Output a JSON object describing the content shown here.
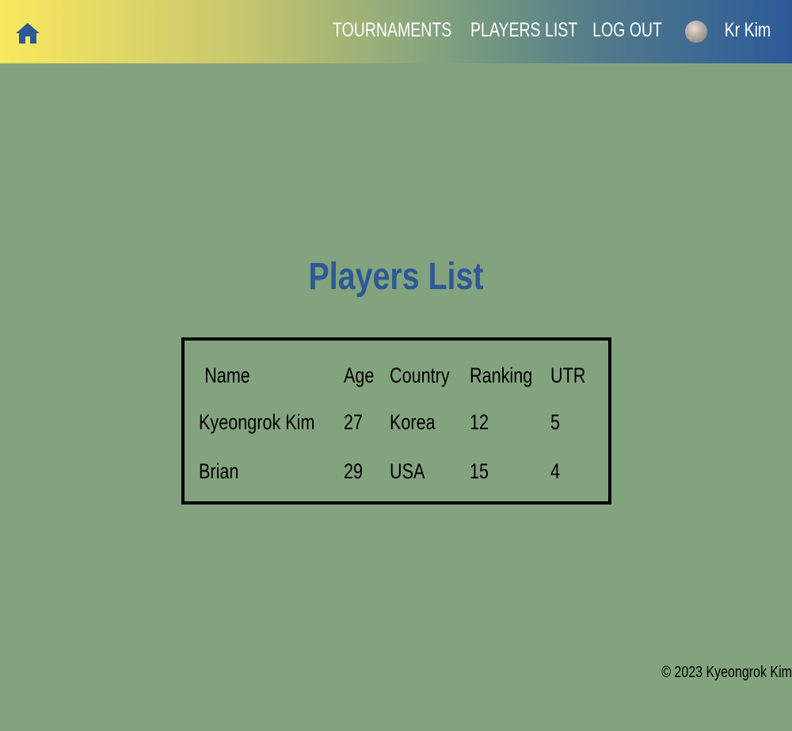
{
  "header": {
    "home_icon": "home-icon",
    "nav": {
      "tournaments": "TOURNAMENTS",
      "players_list": "PLAYERS LIST",
      "log_out": "LOG OUT"
    },
    "user": {
      "avatar_icon": "avatar",
      "name": "Kr Kim"
    }
  },
  "main": {
    "title": "Players List",
    "table": {
      "columns": [
        "Name",
        "Age",
        "Country",
        "Ranking",
        "UTR"
      ],
      "rows": [
        [
          "Kyeongrok Kim",
          "27",
          "Korea",
          "12",
          "5"
        ],
        [
          "Brian",
          "29",
          "USA",
          "15",
          "4"
        ]
      ]
    }
  },
  "footer": {
    "copyright": "© 2023 Kyeongrok Kim"
  },
  "colors": {
    "background": "#83a37e",
    "title": "#2d5a95",
    "home_icon": "#2d5a95",
    "header_gradient_start": "#f7e85e",
    "header_gradient_end": "#2b5a99"
  }
}
